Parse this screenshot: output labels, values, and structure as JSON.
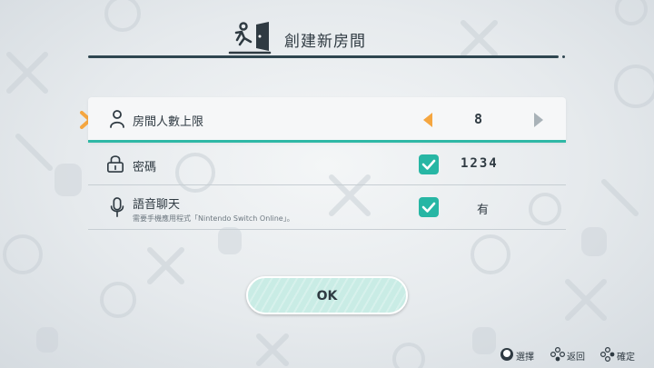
{
  "header": {
    "title": "創建新房間",
    "icon": "room-door-icon"
  },
  "settings": {
    "players": {
      "label": "房間人數上限",
      "value": "8",
      "icon": "person-icon"
    },
    "password": {
      "label": "密碼",
      "value": "1234",
      "checked": true,
      "icon": "lock-icon"
    },
    "voice_chat": {
      "label": "語音聊天",
      "sublabel": "需要手機應用程式「Nintendo Switch Online」。",
      "value": "有",
      "checked": true,
      "icon": "microphone-icon"
    }
  },
  "ok_button": {
    "label": "OK"
  },
  "footer": {
    "select_label": "選擇",
    "back_label": "返回",
    "confirm_label": "確定"
  },
  "colors": {
    "accent": "#27b6a4",
    "cursor": "#f5a640",
    "arrow_disabled": "#a9b2b8",
    "text": "#2f3a42"
  }
}
